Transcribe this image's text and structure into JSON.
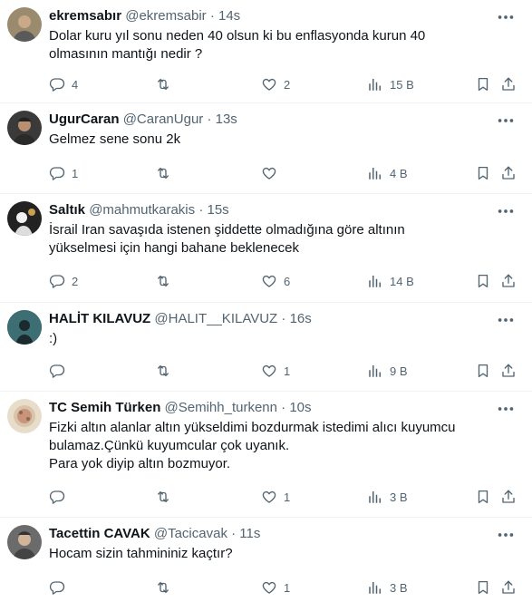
{
  "tweets": [
    {
      "name": "ekremsabır",
      "handle": "@ekremsabir",
      "time": "14s",
      "text": "Dolar kuru  yıl sonu  neden 40  olsun ki  bu enflasyonda  kurun  40 olmasının  mantığı  nedir ?",
      "replies": "4",
      "retweets": "",
      "likes": "2",
      "views": "15 B",
      "avatar_color": "#9a8b6e"
    },
    {
      "name": "UgurCaran",
      "handle": "@CaranUgur",
      "time": "13s",
      "text": "Gelmez sene sonu 2k",
      "replies": "1",
      "retweets": "",
      "likes": "",
      "views": "4 B",
      "avatar_color": "#3a3a3a"
    },
    {
      "name": "Saltık",
      "handle": "@mahmutkarakis",
      "time": "15s",
      "text": "İsrail Iran savaşıda istenen şiddette olmadığına göre altının yükselmesi için hangi bahane beklenecek",
      "replies": "2",
      "retweets": "",
      "likes": "6",
      "views": "14 B",
      "avatar_color": "#222222"
    },
    {
      "name": "HALİT KILAVUZ",
      "handle": "@HALIT__KILAVUZ",
      "time": "16s",
      "text": ":)",
      "replies": "",
      "retweets": "",
      "likes": "1",
      "views": "9 B",
      "avatar_color": "#2f5d62"
    },
    {
      "name": "TC Semih Türken",
      "handle": "@Semihh_turkenn",
      "time": "10s",
      "text": "Fizki altın alanlar altın yükseldimi bozdurmak istedimi alıcı kuyumcu bulamaz.Çünkü kuyumcular çok uyanık.\nPara  yok diyip altın bozmuyor.",
      "replies": "",
      "retweets": "",
      "likes": "1",
      "views": "3 B",
      "avatar_color": "#e8dccb"
    },
    {
      "name": "Tacettin CAVAK",
      "handle": "@Tacicavak",
      "time": "11s",
      "text": "Hocam sizin tahmininiz kaçtır?",
      "replies": "",
      "retweets": "",
      "likes": "1",
      "views": "3 B",
      "avatar_color": "#6b6b6b"
    }
  ],
  "separator": "·",
  "icons": {
    "more": "more-dots-icon",
    "reply": "reply-icon",
    "retweet": "retweet-icon",
    "like": "like-icon",
    "views": "views-icon",
    "bookmark": "bookmark-icon",
    "share": "share-icon"
  },
  "colors": {
    "text": "#0f1419",
    "secondary": "#536471",
    "divider": "#eff3f4"
  }
}
